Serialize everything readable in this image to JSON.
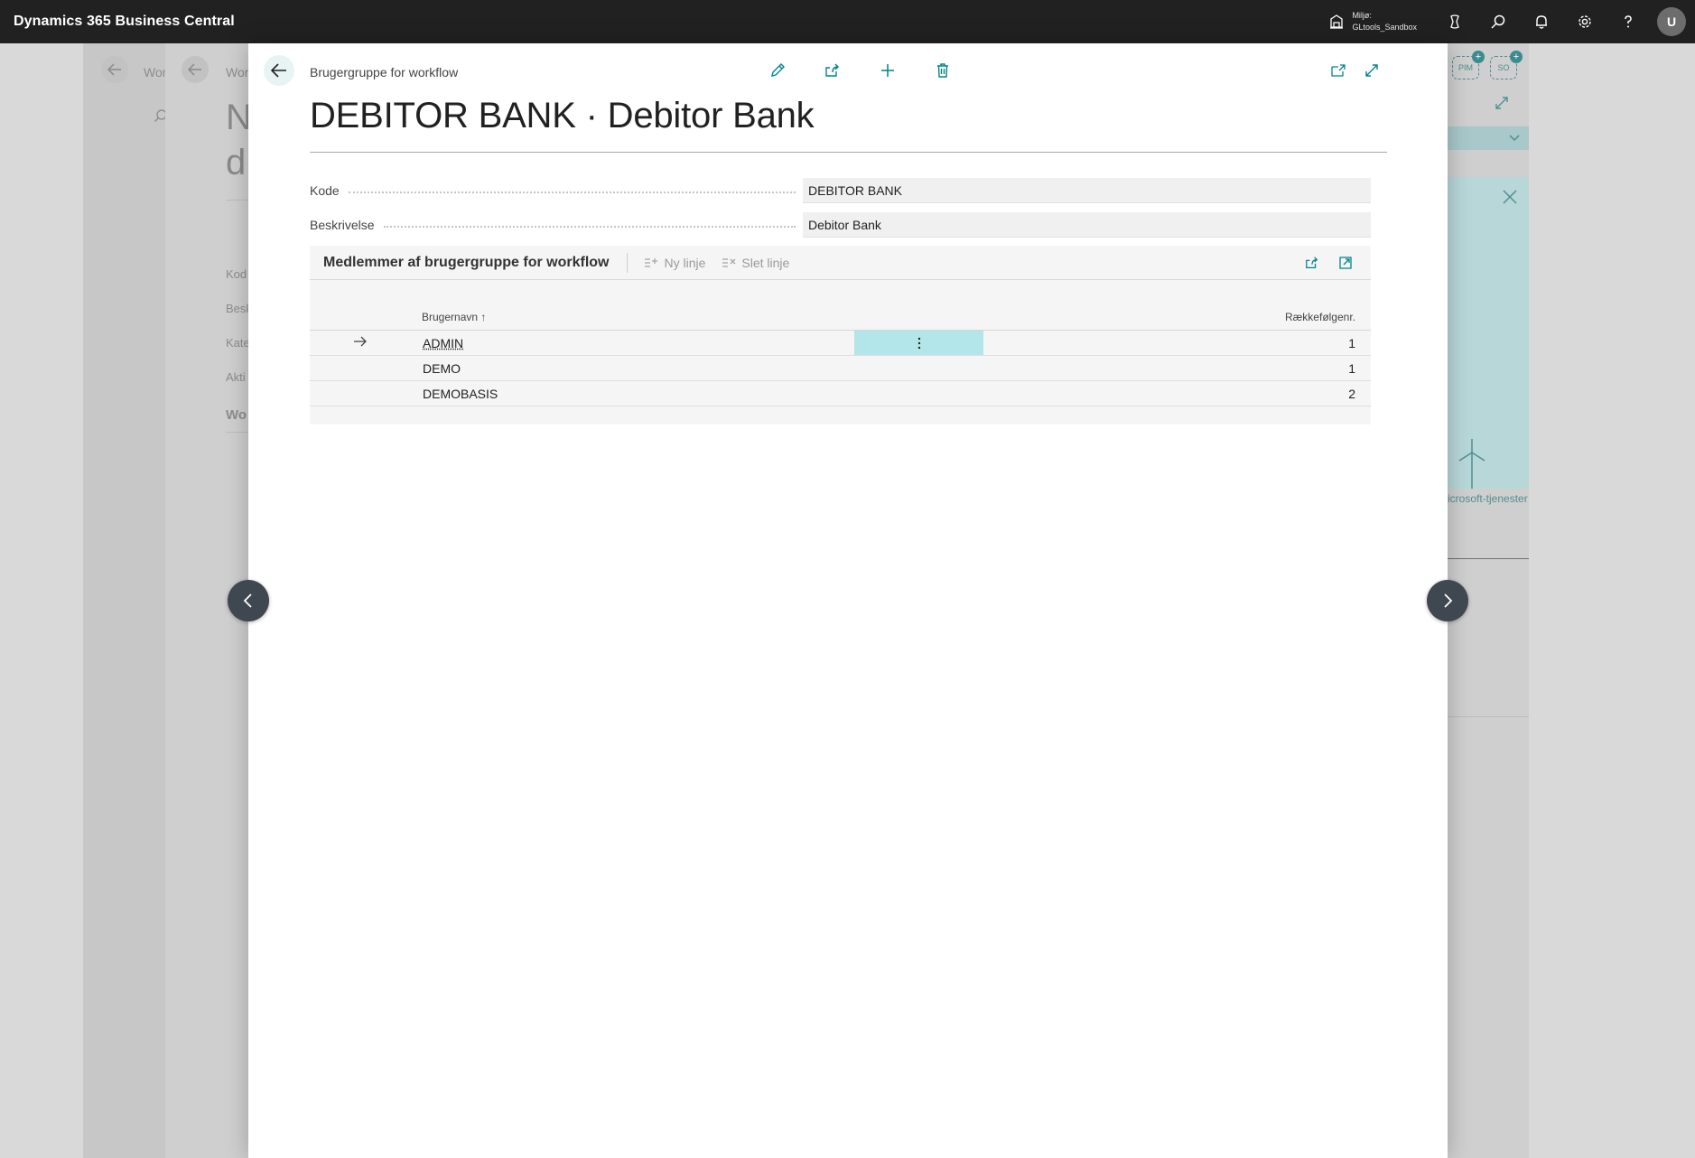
{
  "app": {
    "title": "Dynamics 365 Business Central"
  },
  "environment": {
    "label": "Miljø:",
    "name": "GLtools_Sandbox"
  },
  "user": {
    "initial": "U"
  },
  "background": {
    "page1_title_prefix": "Wor",
    "page2_title_prefix": "Wor",
    "big_title_line1": "N",
    "big_title_line2": "d",
    "field_labels": [
      "Kod",
      "Besk",
      "Kate",
      "Akti"
    ],
    "section_prefix": "Wo",
    "factbox_link": "icrosoft-tjenester",
    "badges": [
      "PIM",
      "SO"
    ]
  },
  "modal": {
    "caption": "Brugergruppe for workflow",
    "title": "DEBITOR BANK · Debitor Bank",
    "fields": {
      "code_label": "Kode",
      "code_value": "DEBITOR BANK",
      "desc_label": "Beskrivelse",
      "desc_value": "Debitor Bank"
    },
    "part": {
      "title": "Medlemmer af brugergruppe for workflow",
      "new_line": "Ny linje",
      "delete_line": "Slet linje",
      "columns": {
        "user": "Brugernavn",
        "sort_indicator": "↑",
        "seq": "Rækkefølgenr."
      },
      "rows": [
        {
          "user": "ADMIN",
          "seq": "1"
        },
        {
          "user": "DEMO",
          "seq": "1"
        },
        {
          "user": "DEMOBASIS",
          "seq": "2"
        }
      ]
    }
  },
  "colors": {
    "accent": "#008489",
    "selected_cell": "#b2e6e8",
    "appbar": "#212121"
  }
}
